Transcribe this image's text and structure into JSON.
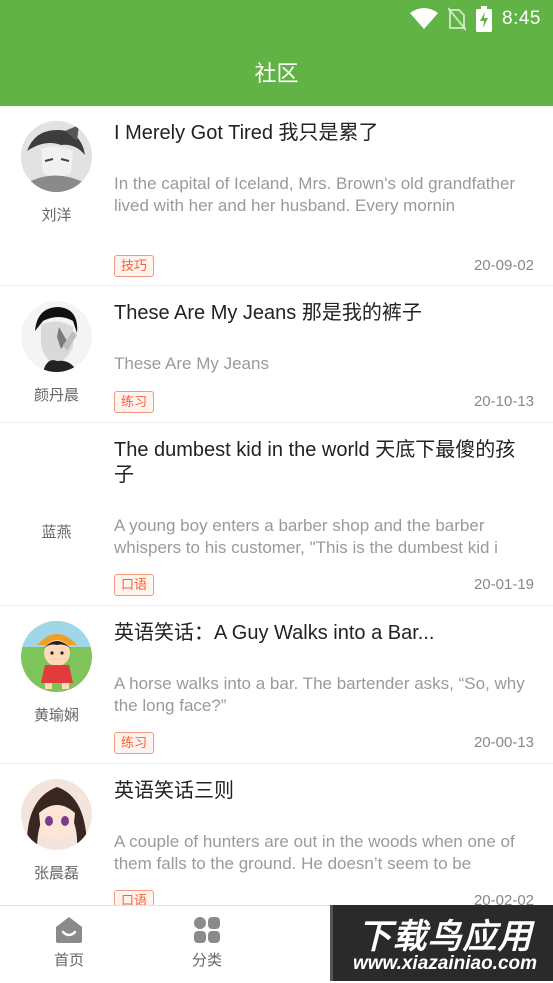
{
  "status_bar": {
    "time": "8:45",
    "icons": [
      "wifi-icon",
      "no-sim-icon",
      "battery-charging-icon"
    ]
  },
  "header": {
    "title": "社区",
    "color": "#62b345"
  },
  "posts": [
    {
      "author": "刘洋",
      "avatar": "avatar-grayscale-anime",
      "title": "I Merely Got Tired 我只是累了",
      "excerpt": "In the capital of Iceland, Mrs. Brown's old grandfather lived with her and her husband. Every mornin",
      "tag": "技巧",
      "date": "20-09-02"
    },
    {
      "author": "颜丹晨",
      "avatar": "avatar-bw-portrait",
      "title": "These Are My Jeans 那是我的裤子",
      "excerpt": "These Are My Jeans",
      "tag": "练习",
      "date": "20-10-13"
    },
    {
      "author": "蓝燕",
      "avatar": "",
      "title": "The dumbest kid in the world 天底下最傻的孩子",
      "excerpt": "A young boy enters a barber shop and the barber whispers to his customer, \"This is the dumbest kid i",
      "tag": "口语",
      "date": "20-01-19"
    },
    {
      "author": "黄瑜娴",
      "avatar": "avatar-cartoon-girl",
      "title": "英语笑话：A Guy Walks into a Bar...",
      "excerpt": "A horse walks into a bar. The bartender asks, “So, why the long face?”",
      "tag": "练习",
      "date": "20-00-13"
    },
    {
      "author": "张晨磊",
      "avatar": "avatar-anime-girl",
      "title": "英语笑话三则",
      "excerpt": "A couple of hunters are out in the woods when one of them falls to the ground. He doesn’t seem to be",
      "tag": "口语",
      "date": "20-02-02"
    }
  ],
  "bottom_nav": [
    {
      "label": "首页",
      "icon": "home-icon"
    },
    {
      "label": "分类",
      "icon": "category-grid-icon"
    }
  ],
  "watermark": {
    "main": "下载鸟应用",
    "sub": "www.xiazainiao.com"
  }
}
